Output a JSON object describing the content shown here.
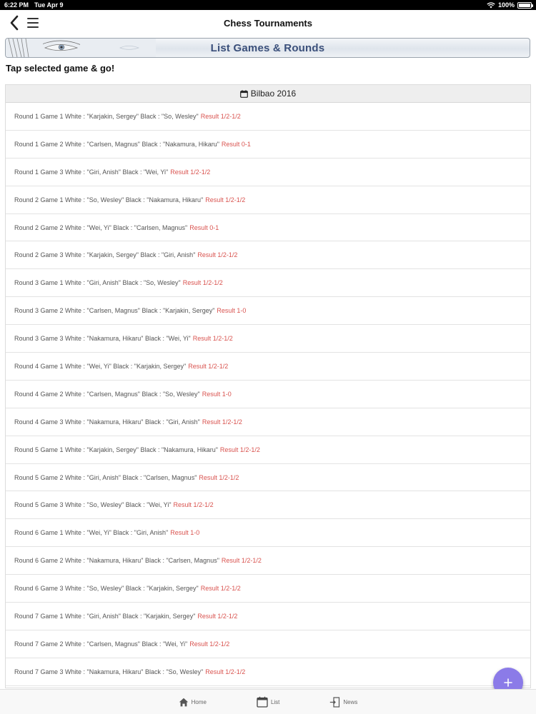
{
  "status": {
    "time": "6:22 PM",
    "date": "Tue Apr 9",
    "battery": "100%"
  },
  "nav": {
    "title": "Chess Tournaments"
  },
  "banner": {
    "title": "List Games & Rounds"
  },
  "hint": "Tap selected game & go!",
  "tournament": {
    "name": "Bilbao 2016"
  },
  "games": [
    {
      "text": "Round 1 Game 1 White : \"Karjakin, Sergey\" Black : \"So, Wesley\"",
      "result": "Result 1/2-1/2"
    },
    {
      "text": "Round 1 Game 2 White : \"Carlsen, Magnus\" Black : \"Nakamura, Hikaru\"",
      "result": "Result 0-1"
    },
    {
      "text": "Round 1 Game 3 White : \"Giri, Anish\" Black : \"Wei, Yi\"",
      "result": "Result 1/2-1/2"
    },
    {
      "text": "Round 2 Game 1 White : \"So, Wesley\" Black : \"Nakamura, Hikaru\"",
      "result": "Result 1/2-1/2"
    },
    {
      "text": "Round 2 Game 2 White : \"Wei, Yi\" Black : \"Carlsen, Magnus\"",
      "result": "Result 0-1"
    },
    {
      "text": "Round 2 Game 3 White : \"Karjakin, Sergey\" Black : \"Giri, Anish\"",
      "result": "Result 1/2-1/2"
    },
    {
      "text": "Round 3 Game 1 White : \"Giri, Anish\" Black : \"So, Wesley\"",
      "result": "Result 1/2-1/2"
    },
    {
      "text": "Round 3 Game 2 White : \"Carlsen, Magnus\" Black : \"Karjakin, Sergey\"",
      "result": "Result 1-0"
    },
    {
      "text": "Round 3 Game 3 White : \"Nakamura, Hikaru\" Black : \"Wei, Yi\"",
      "result": "Result 1/2-1/2"
    },
    {
      "text": "Round 4 Game 1 White : \"Wei, Yi\" Black : \"Karjakin, Sergey\"",
      "result": "Result 1/2-1/2"
    },
    {
      "text": "Round 4 Game 2 White : \"Carlsen, Magnus\" Black : \"So, Wesley\"",
      "result": "Result 1-0"
    },
    {
      "text": "Round 4 Game 3 White : \"Nakamura, Hikaru\" Black : \"Giri, Anish\"",
      "result": "Result 1/2-1/2"
    },
    {
      "text": "Round 5 Game 1 White : \"Karjakin, Sergey\" Black : \"Nakamura, Hikaru\"",
      "result": "Result 1/2-1/2"
    },
    {
      "text": "Round 5 Game 2 White : \"Giri, Anish\" Black : \"Carlsen, Magnus\"",
      "result": "Result 1/2-1/2"
    },
    {
      "text": "Round 5 Game 3 White : \"So, Wesley\" Black : \"Wei, Yi\"",
      "result": "Result 1/2-1/2"
    },
    {
      "text": "Round 6 Game 1 White : \"Wei, Yi\" Black : \"Giri, Anish\"",
      "result": "Result 1-0"
    },
    {
      "text": "Round 6 Game 2 White : \"Nakamura, Hikaru\" Black : \"Carlsen, Magnus\"",
      "result": "Result 1/2-1/2"
    },
    {
      "text": "Round 6 Game 3 White : \"So, Wesley\" Black : \"Karjakin, Sergey\"",
      "result": "Result 1/2-1/2"
    },
    {
      "text": "Round 7 Game 1 White : \"Giri, Anish\" Black : \"Karjakin, Sergey\"",
      "result": "Result 1/2-1/2"
    },
    {
      "text": "Round 7 Game 2 White : \"Carlsen, Magnus\" Black : \"Wei, Yi\"",
      "result": "Result 1/2-1/2"
    },
    {
      "text": "Round 7 Game 3 White : \"Nakamura, Hikaru\" Black : \"So, Wesley\"",
      "result": "Result 1/2-1/2"
    }
  ],
  "tabs": [
    {
      "label": "Home",
      "icon": "home-icon"
    },
    {
      "label": "List",
      "icon": "calendar-icon"
    },
    {
      "label": "News",
      "icon": "news-icon"
    }
  ],
  "colors": {
    "accent": "#8b7be8",
    "result": "#d9534f",
    "banner_text": "#3a4f7a"
  }
}
